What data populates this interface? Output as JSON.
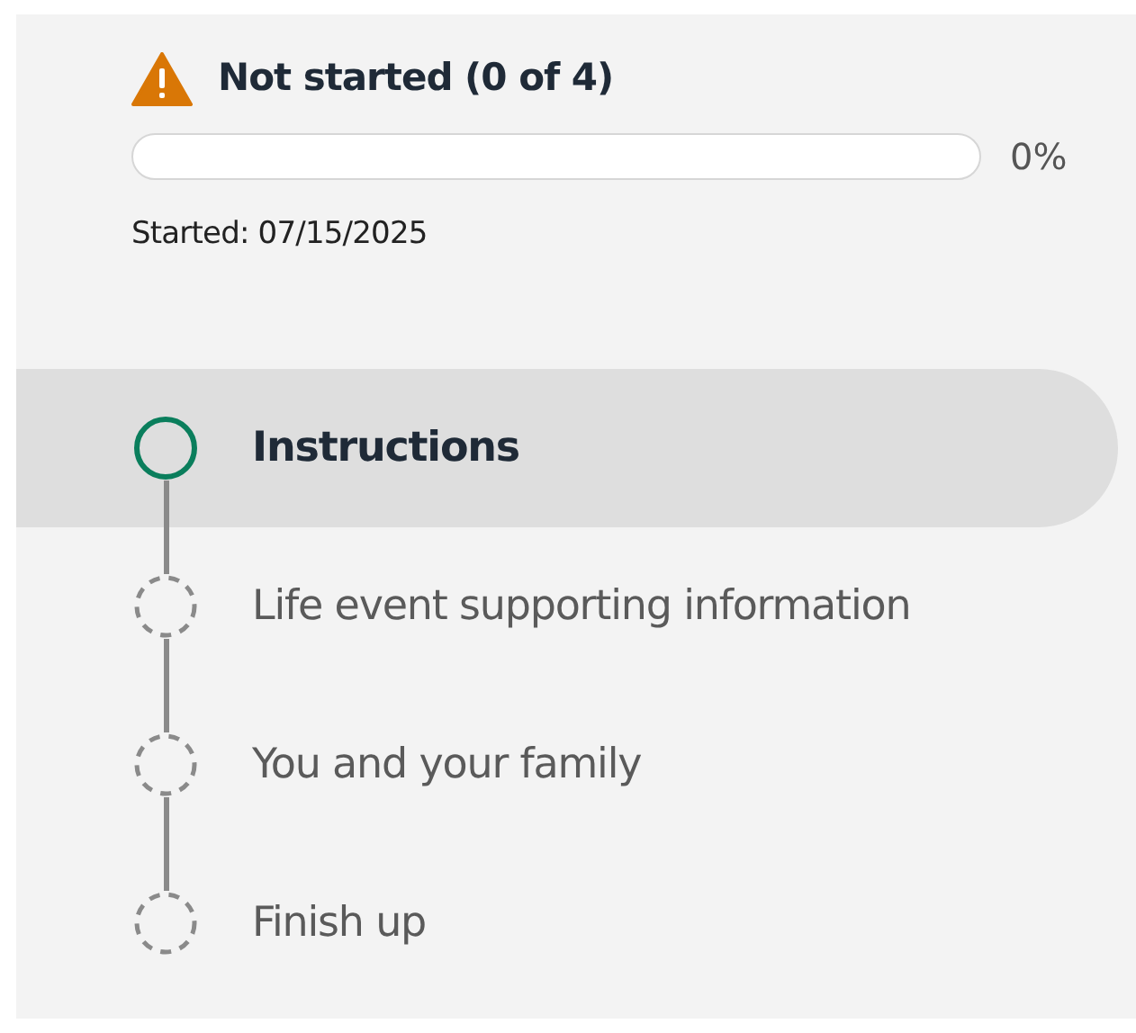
{
  "status": {
    "title": "Not started (0 of 4)",
    "level": 0,
    "percent": "0%",
    "started": "Started: 07/15/2025"
  },
  "steps": [
    {
      "label": "Instructions",
      "selected": true
    },
    {
      "label": "Life event supporting information",
      "selected": false
    },
    {
      "label": "You and your family",
      "selected": false
    },
    {
      "label": "Finish up",
      "selected": false
    }
  ]
}
